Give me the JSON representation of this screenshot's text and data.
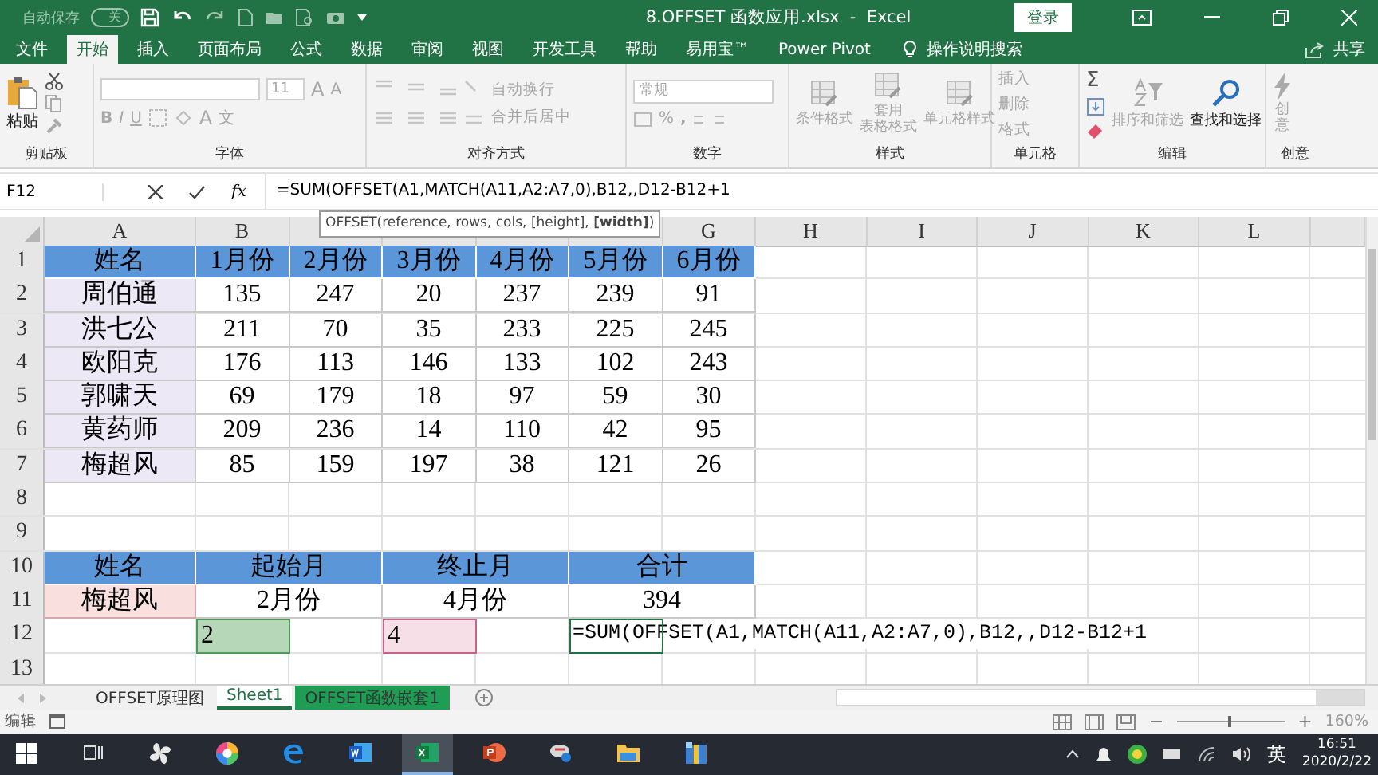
{
  "title_bar": {
    "autosave_label": "自动保存",
    "autosave_state": "关",
    "autosave_on": false,
    "title": "8.OFFSET 函数应用.xlsx  -  Excel",
    "login": "登录"
  },
  "tabs": [
    {
      "label": "文件",
      "selected": false
    },
    {
      "label": "开始",
      "selected": true
    },
    {
      "label": "插入",
      "selected": false
    },
    {
      "label": "页面布局",
      "selected": false
    },
    {
      "label": "公式",
      "selected": false
    },
    {
      "label": "数据",
      "selected": false
    },
    {
      "label": "审阅",
      "selected": false
    },
    {
      "label": "视图",
      "selected": false
    },
    {
      "label": "开发工具",
      "selected": false
    },
    {
      "label": "帮助",
      "selected": false
    },
    {
      "label": "易用宝™",
      "selected": false
    },
    {
      "label": "Power Pivot",
      "selected": false
    }
  ],
  "tell_me": "操作说明搜索",
  "share": "共享",
  "ribbon": {
    "clipboard": {
      "label": "剪贴板",
      "paste": "粘贴",
      "disabled": false
    },
    "font": {
      "label": "字体",
      "size": "11",
      "grow": "A",
      "shrink": "A",
      "bold": "B",
      "italic": "I",
      "underline": "U",
      "font_color": "A",
      "phonetic": "文",
      "disabled": true
    },
    "align": {
      "label": "对齐方式",
      "wrap": "自动换行",
      "merge": "合并后居中",
      "disabled": true
    },
    "number": {
      "label": "数字",
      "format": "常规",
      "percent": "%",
      "comma": ",",
      "disabled": true
    },
    "styles": {
      "label": "样式",
      "buttons": [
        {
          "lines": [
            "条件格式"
          ]
        },
        {
          "lines": [
            "套用",
            "表格格式"
          ]
        },
        {
          "lines": [
            "单元格样式"
          ]
        }
      ],
      "disabled": true
    },
    "cells": {
      "label": "单元格",
      "buttons": [
        "插入",
        "删除",
        "格式"
      ],
      "disabled": true
    },
    "editing": {
      "label": "编辑",
      "sum": "Σ",
      "buttons": [
        {
          "label": "排序和筛选",
          "disabled": true
        },
        {
          "label": "查找和选择",
          "disabled": false
        }
      ]
    },
    "ideas": {
      "label": "创意",
      "button": "创意",
      "disabled": true
    }
  },
  "formula_bar": {
    "name_box": "F12",
    "fx": "fx",
    "formula": "=SUM(OFFSET(A1,MATCH(A11,A2:A7,0),B12,,D12-B12+1",
    "tooltip": "OFFSET(reference, rows, cols, [height], **[width]**)"
  },
  "sheet": {
    "columns": [
      {
        "label": "A"
      },
      {
        "label": "B"
      },
      {
        "covered": true
      },
      {
        "covered": true
      },
      {
        "covered": true
      },
      {
        "covered": true
      },
      {
        "label": "G"
      },
      {
        "label": "H"
      },
      {
        "label": "I"
      },
      {
        "label": "J"
      },
      {
        "label": "K"
      },
      {
        "label": "L"
      }
    ],
    "rows": [
      {
        "number": "1",
        "cells": [
          {
            "text": "姓名",
            "kind": "header"
          },
          {
            "text": "1月份",
            "kind": "header"
          },
          {
            "text": "2月份",
            "kind": "header"
          },
          {
            "text": "3月份",
            "kind": "header"
          },
          {
            "text": "4月份",
            "kind": "header"
          },
          {
            "text": "5月份",
            "kind": "header"
          },
          {
            "text": "6月份",
            "kind": "header"
          }
        ]
      },
      {
        "number": "2",
        "cells": [
          {
            "text": "周伯通",
            "kind": "name"
          },
          {
            "text": "135",
            "kind": "plain"
          },
          {
            "text": "247",
            "kind": "plain"
          },
          {
            "text": "20",
            "kind": "plain"
          },
          {
            "text": "237",
            "kind": "plain"
          },
          {
            "text": "239",
            "kind": "plain"
          },
          {
            "text": "91",
            "kind": "plain"
          }
        ]
      },
      {
        "number": "3",
        "cells": [
          {
            "text": "洪七公",
            "kind": "name"
          },
          {
            "text": "211",
            "kind": "plain"
          },
          {
            "text": "70",
            "kind": "plain"
          },
          {
            "text": "35",
            "kind": "plain"
          },
          {
            "text": "233",
            "kind": "plain"
          },
          {
            "text": "225",
            "kind": "plain"
          },
          {
            "text": "245",
            "kind": "plain"
          }
        ]
      },
      {
        "number": "4",
        "cells": [
          {
            "text": "欧阳克",
            "kind": "name"
          },
          {
            "text": "176",
            "kind": "plain"
          },
          {
            "text": "113",
            "kind": "plain"
          },
          {
            "text": "146",
            "kind": "plain"
          },
          {
            "text": "133",
            "kind": "plain"
          },
          {
            "text": "102",
            "kind": "plain"
          },
          {
            "text": "243",
            "kind": "plain"
          }
        ]
      },
      {
        "number": "5",
        "cells": [
          {
            "text": "郭啸天",
            "kind": "name"
          },
          {
            "text": "69",
            "kind": "plain"
          },
          {
            "text": "179",
            "kind": "plain"
          },
          {
            "text": "18",
            "kind": "plain"
          },
          {
            "text": "97",
            "kind": "plain"
          },
          {
            "text": "59",
            "kind": "plain"
          },
          {
            "text": "30",
            "kind": "plain"
          }
        ]
      },
      {
        "number": "6",
        "cells": [
          {
            "text": "黄药师",
            "kind": "name"
          },
          {
            "text": "209",
            "kind": "plain"
          },
          {
            "text": "236",
            "kind": "plain"
          },
          {
            "text": "14",
            "kind": "plain"
          },
          {
            "text": "110",
            "kind": "plain"
          },
          {
            "text": "42",
            "kind": "plain"
          },
          {
            "text": "95",
            "kind": "plain"
          }
        ]
      },
      {
        "number": "7",
        "cells": [
          {
            "text": "梅超风",
            "kind": "name"
          },
          {
            "text": "85",
            "kind": "plain"
          },
          {
            "text": "159",
            "kind": "plain"
          },
          {
            "text": "197",
            "kind": "plain"
          },
          {
            "text": "38",
            "kind": "plain"
          },
          {
            "text": "121",
            "kind": "plain"
          },
          {
            "text": "26",
            "kind": "plain"
          }
        ]
      },
      {
        "number": "8"
      },
      {
        "number": "9"
      },
      {
        "number": "10",
        "cells": [
          {
            "text": "姓名",
            "kind": "header"
          },
          {
            "text": "起始月",
            "kind": "merged_header"
          },
          {
            "text": "终止月",
            "kind": "merged_header"
          },
          {
            "text": "合计",
            "kind": "merged_header"
          }
        ]
      },
      {
        "number": "11",
        "cells": [
          {
            "text": "梅超风",
            "kind": "lookup"
          },
          {
            "text": "2月份",
            "kind": "merged_plain"
          },
          {
            "text": "4月份",
            "kind": "merged_plain"
          },
          {
            "text": "394",
            "kind": "merged_plain"
          }
        ]
      },
      {
        "number": "12",
        "cells": [
          {
            "kind": "blank"
          },
          {
            "text": "2",
            "kind": "start"
          },
          {
            "kind": "blank"
          },
          {
            "text": "4",
            "kind": "end"
          },
          {
            "kind": "blank"
          },
          {
            "text": "=SUM(OFFSET(A1,MATCH(A11,A2:A7,0),B12,,D12-B12+1",
            "kind": "formula"
          }
        ]
      },
      {
        "number": "13"
      }
    ]
  },
  "sheet_tabs": [
    {
      "label": "OFFSET原理图",
      "selected": false
    },
    {
      "label": "Sheet1",
      "selected": true
    },
    {
      "label": "OFFSET函数嵌套1",
      "selected": false,
      "color": "#1f9d55"
    }
  ],
  "status_bar": {
    "mode": "编辑",
    "zoom_out": "−",
    "zoom_in": "+",
    "zoom": "160%",
    "level": 0.48
  },
  "taskbar": {
    "apps": [
      {
        "kind": "start",
        "selected": false
      },
      {
        "kind": "taskview",
        "selected": false
      },
      {
        "kind": "pinwheel",
        "selected": false
      },
      {
        "kind": "colorwheel",
        "selected": false
      },
      {
        "kind": "edge",
        "selected": false
      },
      {
        "kind": "word",
        "selected": false
      },
      {
        "kind": "excel",
        "selected": true
      },
      {
        "kind": "powerpoint",
        "selected": false
      },
      {
        "kind": "remote",
        "selected": false
      },
      {
        "kind": "folder",
        "selected": false
      },
      {
        "kind": "archive",
        "selected": false
      }
    ],
    "ime": "英",
    "time": "16:51",
    "date": "2020/2/22"
  }
}
